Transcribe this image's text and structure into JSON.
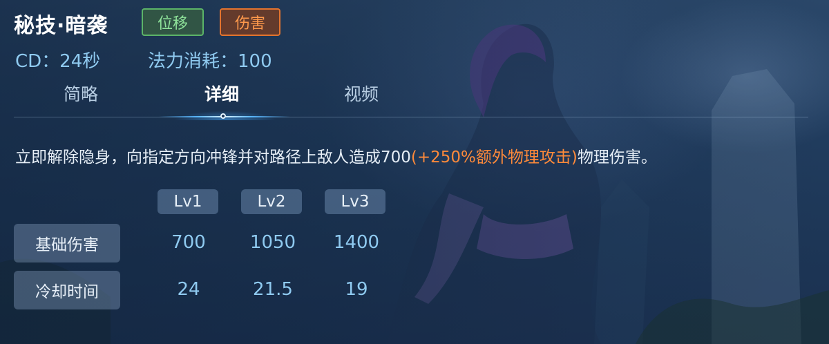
{
  "skill": {
    "name": "秘技·暗袭",
    "tags": [
      {
        "label": "位移",
        "color": "#5cb468"
      },
      {
        "label": "伤害",
        "color": "#e4742e"
      }
    ],
    "cd_text": "CD：24秒",
    "mana_text": "法力消耗：100"
  },
  "tabs": [
    {
      "label": "简略"
    },
    {
      "label": "详细",
      "active": true
    },
    {
      "label": "视频"
    }
  ],
  "description": {
    "prefix": "立即解除隐身，向指定方向冲锋并对路径上敌人造成700",
    "highlight": "(+250%额外物理攻击)",
    "suffix": "物理伤害。"
  },
  "level_table": {
    "headers": [
      "Lv1",
      "Lv2",
      "Lv3"
    ],
    "rows": [
      {
        "label": "基础伤害",
        "values": [
          "700",
          "1050",
          "1400"
        ]
      },
      {
        "label": "冷却时间",
        "values": [
          "24",
          "21.5",
          "19"
        ]
      }
    ]
  },
  "colors": {
    "accent_blue": "#8fcaf0",
    "highlight_orange": "#ff8a3a"
  }
}
